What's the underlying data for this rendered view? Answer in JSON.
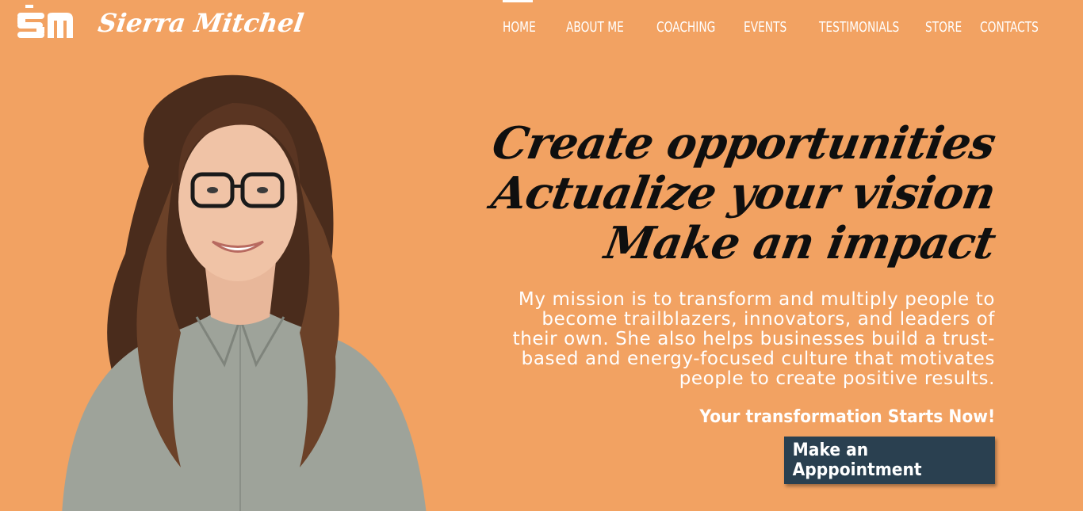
{
  "brand": {
    "logo_icon": "sm-monogram-icon",
    "name": "Sierra Mitchel"
  },
  "nav": {
    "items": [
      {
        "label": "HOME",
        "active": true
      },
      {
        "label": "ABOUT ME"
      },
      {
        "label": "COACHING"
      },
      {
        "label": "EVENTS"
      },
      {
        "label": "TESTIMONIALS"
      },
      {
        "label": "STORE"
      },
      {
        "label": "CONTACTS"
      }
    ]
  },
  "hero": {
    "headline": [
      "Create opportunities",
      "Actualize your vision",
      "Make an impact"
    ],
    "mission": "My mission is to transform and multiply people to become trailblazers, innovators, and leaders of their own. She also helps businesses build a trust-based and energy-focused culture that motivates people to create positive results.",
    "cta_text": "Your transformation Starts Now!",
    "cta_button": "Make an Apppointment",
    "portrait": "portrait-photo"
  },
  "colors": {
    "background": "#f2a262",
    "button": "#2a4050",
    "headline": "#0f0f0f",
    "text": "#ffffff"
  }
}
